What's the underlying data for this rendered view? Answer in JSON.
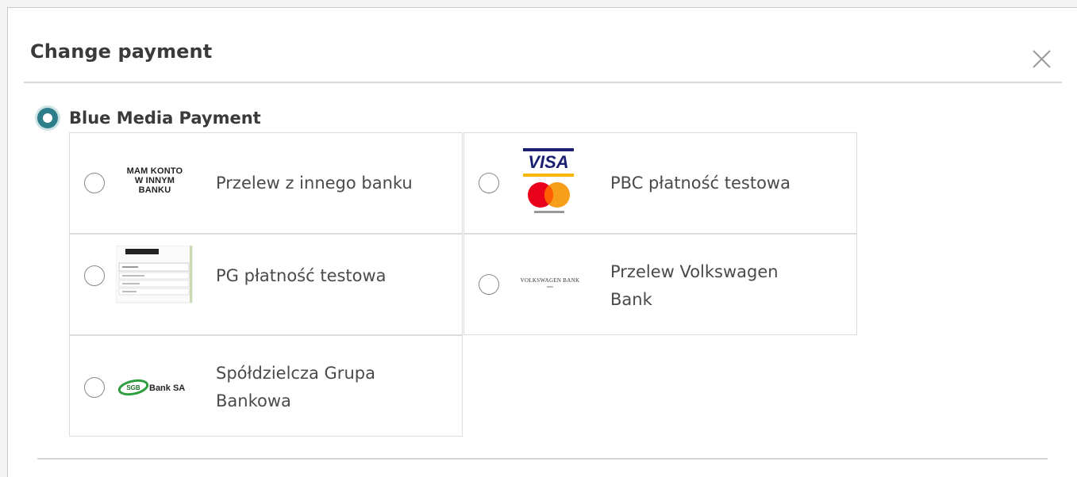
{
  "modal": {
    "title": "Change payment",
    "close_icon": "close-icon"
  },
  "payment_method": {
    "label": "Blue Media Payment",
    "selected": true
  },
  "options": [
    {
      "label": "Przelew z innego banku",
      "logo": "mam-konto-w-innym-banku-logo",
      "logo_text": "MAM KONTO W INNYM BANKU"
    },
    {
      "label": "PBC płatność testowa",
      "logo": "visa-mastercard-logo",
      "logo_text": "VISA"
    },
    {
      "label": "PG płatność testowa",
      "logo": "pg-screenshot-logo"
    },
    {
      "label": "Przelew Volkswagen Bank",
      "logo": "volkswagen-bank-logo",
      "logo_text": "VOLKSWAGEN BANK"
    },
    {
      "label": "Spółdzielcza Grupa Bankowa",
      "logo": "sgb-bank-logo",
      "logo_text": "Bank SA"
    }
  ],
  "colors": {
    "accent": "#2d7d8a",
    "visa_blue": "#1a1f71",
    "mc_red": "#eb001b",
    "mc_orange": "#f79e1b",
    "sgb_green": "#2e9e3e"
  }
}
